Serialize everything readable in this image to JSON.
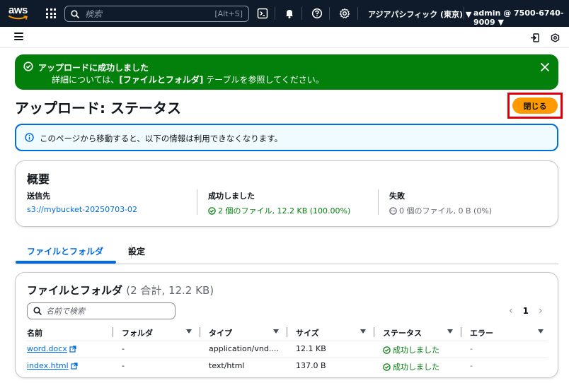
{
  "topbar": {
    "logo": "aws",
    "search_placeholder": "検索",
    "search_shortcut": "[Alt+S]",
    "region": "アジアパシフィック (東京) ▼",
    "account": "admin @ 7500-6740-9009 ▼"
  },
  "flash": {
    "title": "アップロードに成功しました",
    "detail_prefix": "詳細については、",
    "detail_bold": "[ファイルとフォルダ]",
    "detail_suffix": " テーブルを参照してください。"
  },
  "page": {
    "title": "アップロード: ステータス",
    "close_button": "閉じる"
  },
  "info": {
    "text": "このページから移動すると、以下の情報は利用できなくなります。"
  },
  "summary": {
    "title": "概要",
    "destination_label": "送信先",
    "destination_value": "s3://mybucket-20250703-02",
    "success_label": "成功しました",
    "success_value": "2 個のファイル, 12.2 KB (100.00%)",
    "failed_label": "失敗",
    "failed_value": "0 個のファイル, 0 B (0%)"
  },
  "tabs": [
    {
      "label": "ファイルとフォルダ",
      "active": true
    },
    {
      "label": "設定",
      "active": false
    }
  ],
  "files": {
    "title": "ファイルとフォルダ",
    "count": "(2 合計, 12.2 KB)",
    "filter_placeholder": "名前で検索",
    "page": "1",
    "columns": [
      "名前",
      "フォルダ",
      "タイプ",
      "サイズ",
      "ステータス",
      "エラー"
    ],
    "rows": [
      {
        "name": "word.docx",
        "folder": "-",
        "type": "application/vnd....",
        "size": "12.1 KB",
        "status": "成功しました",
        "error": "-"
      },
      {
        "name": "index.html",
        "folder": "-",
        "type": "text/html",
        "size": "137.0 B",
        "status": "成功しました",
        "error": "-"
      }
    ]
  },
  "colors": {
    "success": "#037f0c",
    "accent": "#006ce0",
    "primary_button": "#ff9900",
    "topbar": "#0f1b2a"
  }
}
